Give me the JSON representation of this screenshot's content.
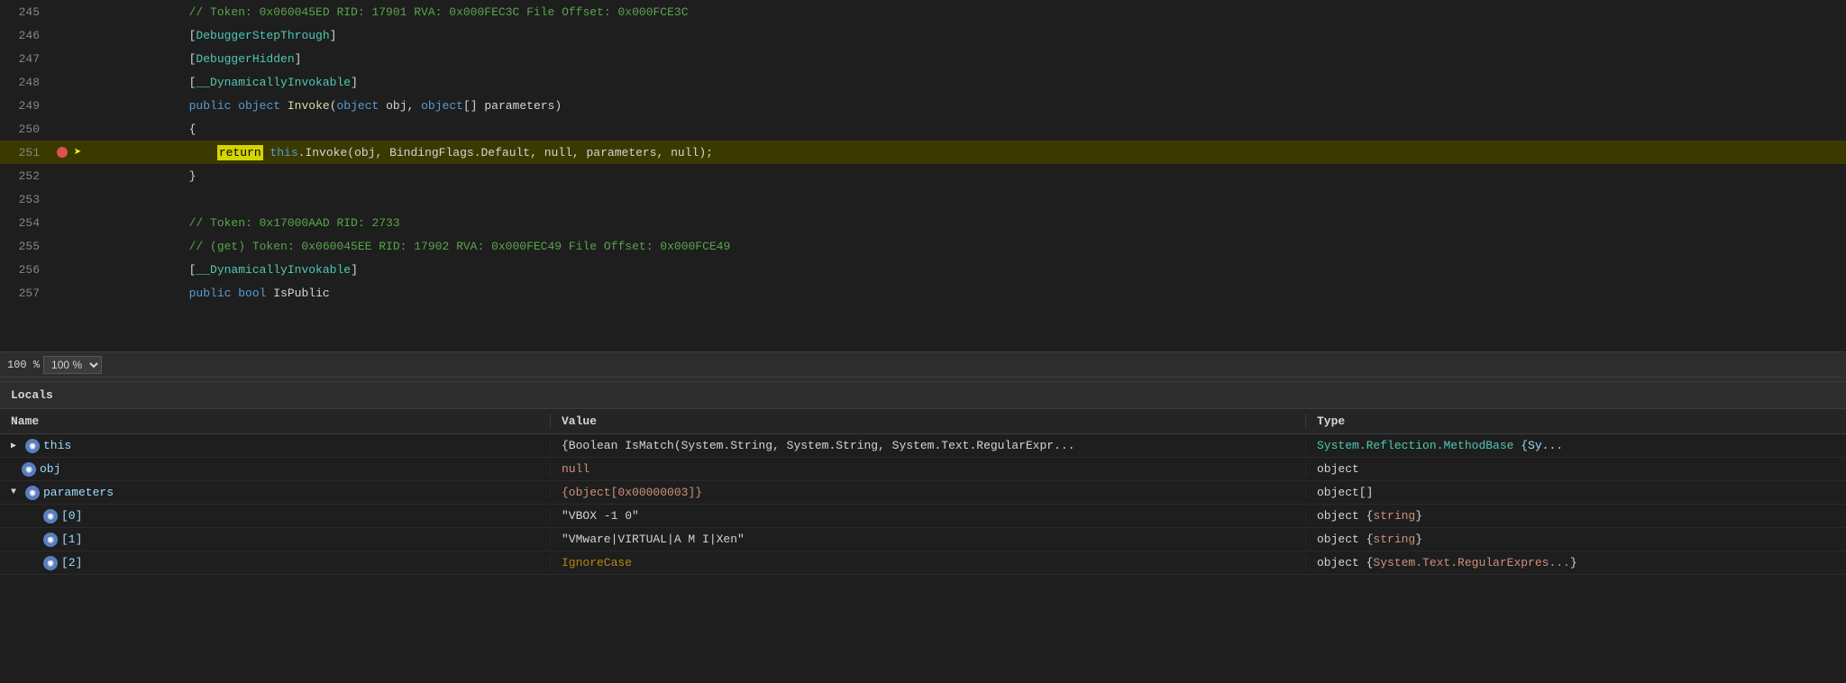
{
  "editor": {
    "lines": [
      {
        "number": "245",
        "content_parts": [
          {
            "text": "            // Token: 0x060045ED RID: 17901 RVA: 0x000FEC3C File Offset: 0x000FCE3C",
            "class": "c-comment"
          }
        ],
        "highlighted": false,
        "hasBreakpoint": false,
        "hasArrow": false
      },
      {
        "number": "246",
        "content_parts": [
          {
            "text": "            [",
            "class": "c-plain"
          },
          {
            "text": "DebuggerStepThrough",
            "class": "c-attribute"
          },
          {
            "text": "]",
            "class": "c-plain"
          }
        ],
        "highlighted": false,
        "hasBreakpoint": false,
        "hasArrow": false
      },
      {
        "number": "247",
        "content_parts": [
          {
            "text": "            [",
            "class": "c-plain"
          },
          {
            "text": "DebuggerHidden",
            "class": "c-attribute"
          },
          {
            "text": "]",
            "class": "c-plain"
          }
        ],
        "highlighted": false,
        "hasBreakpoint": false,
        "hasArrow": false
      },
      {
        "number": "248",
        "content_parts": [
          {
            "text": "            [",
            "class": "c-plain"
          },
          {
            "text": "__DynamicallyInvokable",
            "class": "c-attribute"
          },
          {
            "text": "]",
            "class": "c-plain"
          }
        ],
        "highlighted": false,
        "hasBreakpoint": false,
        "hasArrow": false
      },
      {
        "number": "249",
        "content_parts": [
          {
            "text": "            ",
            "class": "c-plain"
          },
          {
            "text": "public",
            "class": "c-keyword"
          },
          {
            "text": " ",
            "class": "c-plain"
          },
          {
            "text": "object",
            "class": "c-keyword"
          },
          {
            "text": " ",
            "class": "c-plain"
          },
          {
            "text": "Invoke",
            "class": "c-method"
          },
          {
            "text": "(",
            "class": "c-plain"
          },
          {
            "text": "object",
            "class": "c-keyword"
          },
          {
            "text": " obj, ",
            "class": "c-plain"
          },
          {
            "text": "object",
            "class": "c-keyword"
          },
          {
            "text": "[] parameters)",
            "class": "c-plain"
          }
        ],
        "highlighted": false,
        "hasBreakpoint": false,
        "hasArrow": false
      },
      {
        "number": "250",
        "content_parts": [
          {
            "text": "            {",
            "class": "c-plain"
          }
        ],
        "highlighted": false,
        "hasBreakpoint": false,
        "hasArrow": false
      },
      {
        "number": "251",
        "content_parts": [
          {
            "text": "                ",
            "class": "c-plain"
          },
          {
            "text": "return",
            "class": "c-keyword highlight-return-word"
          },
          {
            "text": " ",
            "class": "c-plain"
          },
          {
            "text": "this",
            "class": "c-keyword"
          },
          {
            "text": ".Invoke(obj, BindingFlags.Default, null, parameters, null);",
            "class": "c-plain"
          }
        ],
        "highlighted": true,
        "hasBreakpoint": true,
        "hasArrow": true
      },
      {
        "number": "252",
        "content_parts": [
          {
            "text": "            }",
            "class": "c-plain"
          }
        ],
        "highlighted": false,
        "hasBreakpoint": false,
        "hasArrow": false
      },
      {
        "number": "253",
        "content_parts": [],
        "highlighted": false,
        "hasBreakpoint": false,
        "hasArrow": false
      },
      {
        "number": "254",
        "content_parts": [
          {
            "text": "            // Token: 0x17000AAD RID: 2733",
            "class": "c-comment"
          }
        ],
        "highlighted": false,
        "hasBreakpoint": false,
        "hasArrow": false
      },
      {
        "number": "255",
        "content_parts": [
          {
            "text": "            // (get) Token: 0x060045EE RID: 17902 RVA: 0x000FEC49 File Offset: 0x000FCE49",
            "class": "c-comment"
          }
        ],
        "highlighted": false,
        "hasBreakpoint": false,
        "hasArrow": false
      },
      {
        "number": "256",
        "content_parts": [
          {
            "text": "            [",
            "class": "c-plain"
          },
          {
            "text": "__DynamicallyInvokable",
            "class": "c-attribute"
          },
          {
            "text": "]",
            "class": "c-plain"
          }
        ],
        "highlighted": false,
        "hasBreakpoint": false,
        "hasArrow": false
      },
      {
        "number": "257",
        "content_parts": [
          {
            "text": "            ",
            "class": "c-plain"
          },
          {
            "text": "public",
            "class": "c-keyword"
          },
          {
            "text": " ",
            "class": "c-plain"
          },
          {
            "text": "bool",
            "class": "c-keyword"
          },
          {
            "text": " IsPublic",
            "class": "c-plain"
          }
        ],
        "highlighted": false,
        "hasBreakpoint": false,
        "hasArrow": false
      }
    ],
    "zoom": "100 %"
  },
  "locals": {
    "title": "Locals",
    "columns": {
      "name": "Name",
      "value": "Value",
      "type": "Type"
    },
    "rows": [
      {
        "indent": 0,
        "expand": "collapsed",
        "icon": true,
        "name": "this",
        "value": "{Boolean IsMatch(System.String, System.String, System.Text.RegularExpr...",
        "value_class": "c-plain",
        "type_parts": [
          {
            "text": "System.Reflection.",
            "class": "type-main"
          },
          {
            "text": "MethodBase",
            "class": "type-main"
          },
          {
            "text": " {Sy...",
            "class": "type-secondary"
          }
        ]
      },
      {
        "indent": 0,
        "expand": "leaf",
        "icon": true,
        "name": "obj",
        "value": "null",
        "value_class": "var-value-null",
        "type_parts": [
          {
            "text": "object",
            "class": "c-plain"
          }
        ]
      },
      {
        "indent": 0,
        "expand": "expanded",
        "icon": true,
        "name": "parameters",
        "value": "{object[0x00000003]}",
        "value_class": "var-value-object",
        "type_parts": [
          {
            "text": "object[]",
            "class": "c-plain"
          }
        ]
      },
      {
        "indent": 1,
        "expand": "leaf",
        "icon": true,
        "name": "[0]",
        "value": "\"VBOX  -1 0\"",
        "value_class": "var-value-string",
        "type_parts": [
          {
            "text": "object",
            "class": "c-plain"
          },
          {
            "text": " {",
            "class": "c-plain"
          },
          {
            "text": "string",
            "class": "c-orange"
          },
          {
            "text": "}",
            "class": "c-plain"
          }
        ]
      },
      {
        "indent": 1,
        "expand": "leaf",
        "icon": true,
        "name": "[1]",
        "value": "\"VMware|VIRTUAL|A M I|Xen\"",
        "value_class": "var-value-string",
        "type_parts": [
          {
            "text": "object",
            "class": "c-plain"
          },
          {
            "text": " {",
            "class": "c-plain"
          },
          {
            "text": "string",
            "class": "c-orange"
          },
          {
            "text": "}",
            "class": "c-plain"
          }
        ]
      },
      {
        "indent": 1,
        "expand": "leaf",
        "icon": true,
        "name": "[2]",
        "value": "IgnoreCase",
        "value_class": "var-value-enum",
        "type_parts": [
          {
            "text": "object",
            "class": "c-plain"
          },
          {
            "text": " {",
            "class": "c-plain"
          },
          {
            "text": "System.Text.RegularExpres...",
            "class": "c-orange"
          },
          {
            "text": "}",
            "class": "c-plain"
          }
        ]
      }
    ]
  }
}
